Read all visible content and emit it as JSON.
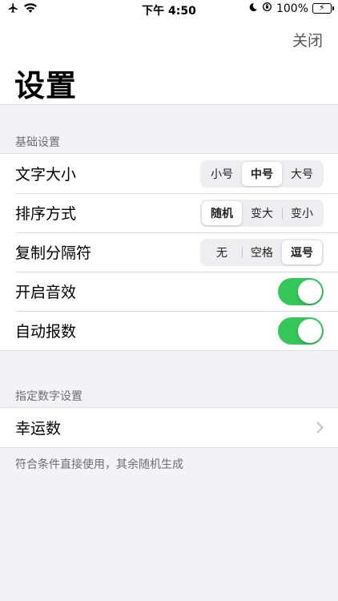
{
  "status_bar": {
    "time": "下午 4:50",
    "battery": "100%",
    "battery_level": 1.0
  },
  "nav": {
    "close_label": "关闭",
    "title": "设置"
  },
  "basic_section": {
    "header": "基础设置",
    "font_size": {
      "label": "文字大小",
      "options": [
        "小号",
        "中号",
        "大号"
      ],
      "selected": "中号"
    },
    "sort": {
      "label": "排序方式",
      "options": [
        "随机",
        "变大",
        "变小"
      ],
      "selected": "随机"
    },
    "separator": {
      "label": "复制分隔符",
      "options": [
        "无",
        "空格",
        "逗号"
      ],
      "selected": "逗号"
    },
    "sound": {
      "label": "开启音效",
      "on": true
    },
    "auto_announce": {
      "label": "自动报数",
      "on": true
    }
  },
  "number_section": {
    "header": "指定数字设置",
    "lucky_number": {
      "label": "幸运数"
    },
    "footer": "符合条件直接使用，其余随机生成"
  },
  "colors": {
    "accent_green": "#34c759",
    "background": "#f2f2f7"
  }
}
